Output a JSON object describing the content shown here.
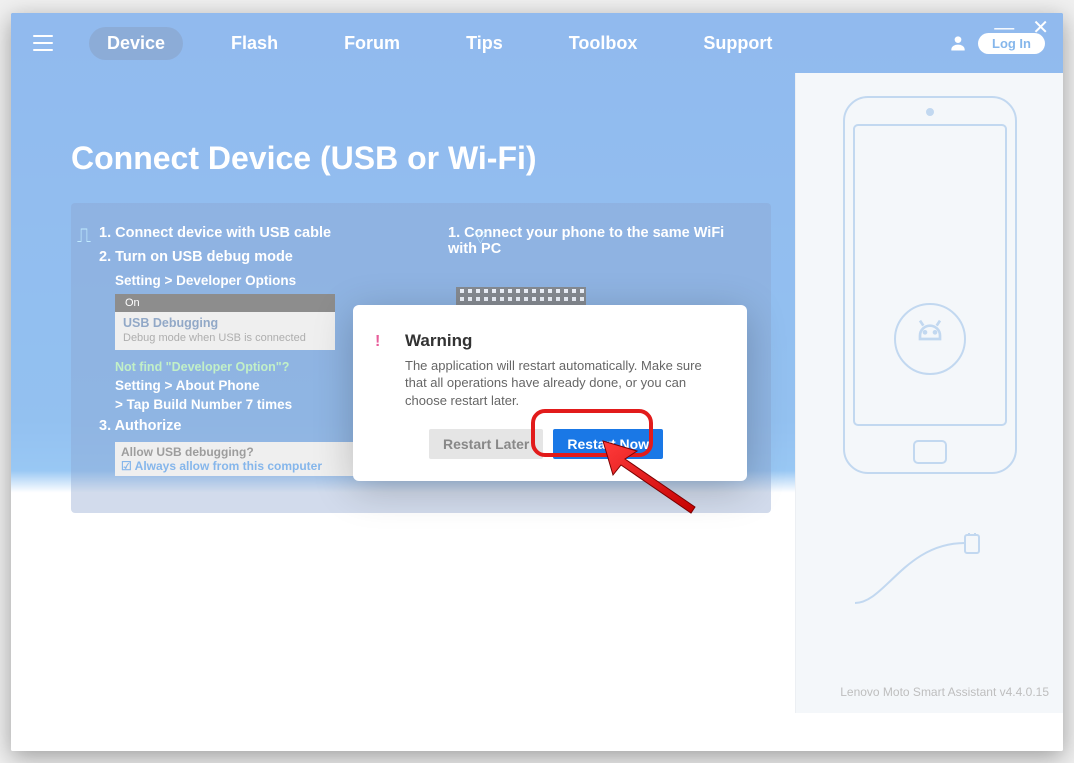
{
  "window": {
    "minimize": "—",
    "close": "✕"
  },
  "nav": {
    "tabs": [
      "Device",
      "Flash",
      "Forum",
      "Tips",
      "Toolbox",
      "Support"
    ],
    "active": "Device",
    "login": "Log In"
  },
  "page": {
    "title": "Connect Device (USB or Wi-Fi)"
  },
  "usb": {
    "step1": "1. Connect device with USB cable",
    "step2": "2. Turn on USB debug mode",
    "breadcrumb1": "Setting > Developer Options",
    "switch_header": "On",
    "switch_title": "USB Debugging",
    "switch_sub": "Debug mode when USB is connected",
    "notfind": "Not find \"Developer Option\"?",
    "breadcrumb2": "Setting > About Phone",
    "tap_build": "> Tap Build Number 7 times",
    "step3": "3. Authorize",
    "allow_q": "Allow USB debugging?",
    "allow_chk": "☑ Always allow from this computer"
  },
  "wifi": {
    "step1": "1. Connect your phone to the same WiFi with PC"
  },
  "modal": {
    "title": "Warning",
    "body": "The application will restart automatically. Make sure that all operations have already done, or you can choose restart later.",
    "later": "Restart Later",
    "now": "Restart Now"
  },
  "footer": {
    "version": "Lenovo Moto Smart Assistant v4.4.0.15"
  }
}
